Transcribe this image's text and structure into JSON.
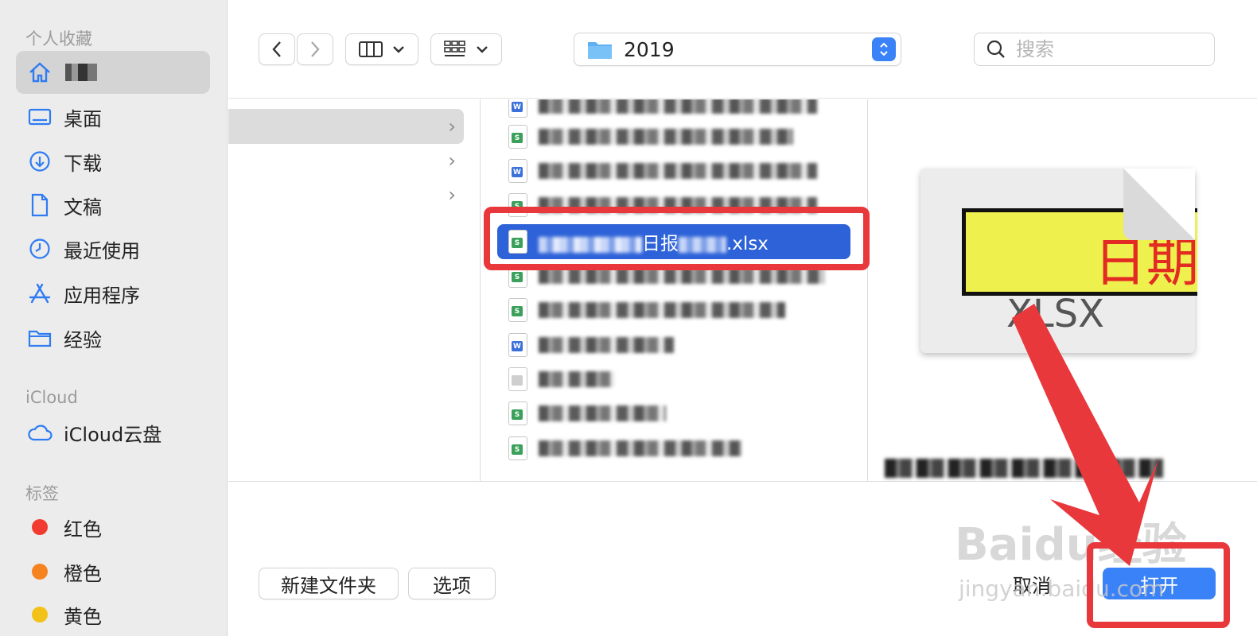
{
  "sidebar": {
    "favorites_title": "个人收藏",
    "items": [
      {
        "label": "",
        "icon": "home-icon"
      },
      {
        "label": "桌面",
        "icon": "desktop-icon"
      },
      {
        "label": "下载",
        "icon": "download-icon"
      },
      {
        "label": "文稿",
        "icon": "document-icon"
      },
      {
        "label": "最近使用",
        "icon": "clock-icon"
      },
      {
        "label": "应用程序",
        "icon": "applications-icon"
      },
      {
        "label": "经验",
        "icon": "folder-icon"
      }
    ],
    "icloud_title": "iCloud",
    "icloud_drive": "iCloud云盘",
    "tags_title": "标签",
    "tags": [
      {
        "label": "红色",
        "color": "#f23b30"
      },
      {
        "label": "橙色",
        "color": "#f5831f"
      },
      {
        "label": "黄色",
        "color": "#f2c218"
      }
    ]
  },
  "toolbar": {
    "path": "2019",
    "search_placeholder": "搜索"
  },
  "files": {
    "selected_name_part": "日报",
    "selected_ext": ".xlsx",
    "rows": [
      {
        "type": "w"
      },
      {
        "type": "s"
      },
      {
        "type": "w"
      },
      {
        "type": "s"
      },
      {
        "type": "s",
        "selected": true
      },
      {
        "type": "s"
      },
      {
        "type": "s"
      },
      {
        "type": "w"
      },
      {
        "type": "t"
      },
      {
        "type": "s"
      },
      {
        "type": "s"
      }
    ]
  },
  "preview": {
    "doc_text": "日期",
    "doc_ext": "XLSX"
  },
  "footer": {
    "new_folder": "新建文件夹",
    "options": "选项",
    "cancel": "取消",
    "open": "打开"
  },
  "watermark": {
    "brand": "Baidu经验",
    "url": "jingyan.baidu.com"
  },
  "colors": {
    "accent": "#3a82f7",
    "selection": "#2d62d8",
    "annotation": "#e8383c"
  }
}
